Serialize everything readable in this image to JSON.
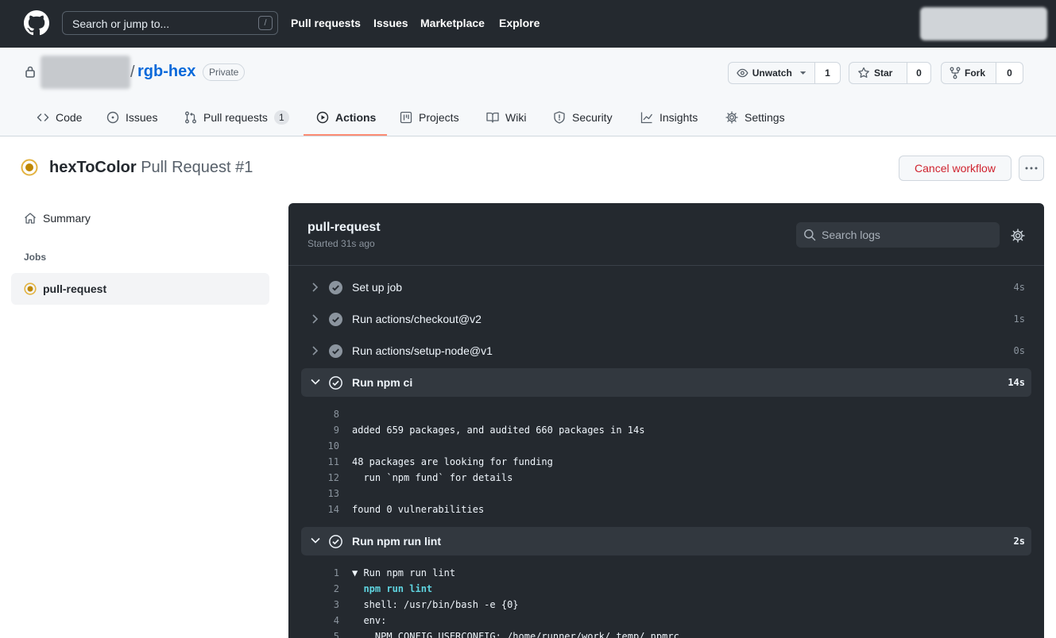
{
  "global_header": {
    "search_placeholder": "Search or jump to...",
    "search_shortcut": "/",
    "nav": [
      "Pull requests",
      "Issues",
      "Marketplace",
      "Explore"
    ]
  },
  "repo": {
    "name": "rgb-hex",
    "visibility": "Private",
    "watch": {
      "label": "Unwatch",
      "count": "1"
    },
    "star": {
      "label": "Star",
      "count": "0"
    },
    "fork": {
      "label": "Fork",
      "count": "0"
    }
  },
  "tabs": [
    {
      "label": "Code",
      "icon": "code-icon"
    },
    {
      "label": "Issues",
      "icon": "issue-opened-icon"
    },
    {
      "label": "Pull requests",
      "icon": "git-pull-request-icon",
      "count": "1"
    },
    {
      "label": "Actions",
      "icon": "play-icon",
      "selected": true
    },
    {
      "label": "Projects",
      "icon": "project-icon"
    },
    {
      "label": "Wiki",
      "icon": "book-icon"
    },
    {
      "label": "Security",
      "icon": "shield-icon"
    },
    {
      "label": "Insights",
      "icon": "graph-icon"
    },
    {
      "label": "Settings",
      "icon": "gear-icon"
    }
  ],
  "workflow": {
    "name": "hexToColor",
    "run": "Pull Request #1",
    "status": "in-progress",
    "cancel_label": "Cancel workflow",
    "more_label": "···"
  },
  "sidebar": {
    "summary_label": "Summary",
    "jobs_heading": "Jobs",
    "job_label": "pull-request"
  },
  "job": {
    "title": "pull-request",
    "started": "Started 31s ago",
    "search_placeholder": "Search logs",
    "steps": [
      {
        "label": "Set up job",
        "duration": "4s",
        "expanded": false
      },
      {
        "label": "Run actions/checkout@v2",
        "duration": "1s",
        "expanded": false
      },
      {
        "label": "Run actions/setup-node@v1",
        "duration": "0s",
        "expanded": false
      },
      {
        "label": "Run npm ci",
        "duration": "14s",
        "expanded": true
      },
      {
        "label": "Run npm run lint",
        "duration": "2s",
        "expanded": true
      }
    ],
    "npm_ci_log": [
      {
        "n": "8",
        "text": ""
      },
      {
        "n": "9",
        "text": "added 659 packages, and audited 660 packages in 14s"
      },
      {
        "n": "10",
        "text": ""
      },
      {
        "n": "11",
        "text": "48 packages are looking for funding"
      },
      {
        "n": "12",
        "text": "  run `npm fund` for details"
      },
      {
        "n": "13",
        "text": ""
      },
      {
        "n": "14",
        "text": "found 0 vulnerabilities"
      }
    ],
    "lint_log": [
      {
        "n": "1",
        "text": "▼ Run npm run lint"
      },
      {
        "n": "2",
        "text": "  npm run lint"
      },
      {
        "n": "3",
        "text": "  shell: /usr/bin/bash -e {0}"
      },
      {
        "n": "4",
        "text": "  env:"
      },
      {
        "n": "5",
        "text": "    NPM_CONFIG_USERCONFIG: /home/runner/work/_temp/.npmrc"
      }
    ]
  },
  "colors": {
    "header_bg": "#24292f",
    "link": "#0969da",
    "tab_selected_underline": "#fd8c73",
    "in_progress": "#bf8700",
    "danger": "#cf222e",
    "log_bg": "#24292f",
    "command": "#5fd4e0"
  }
}
